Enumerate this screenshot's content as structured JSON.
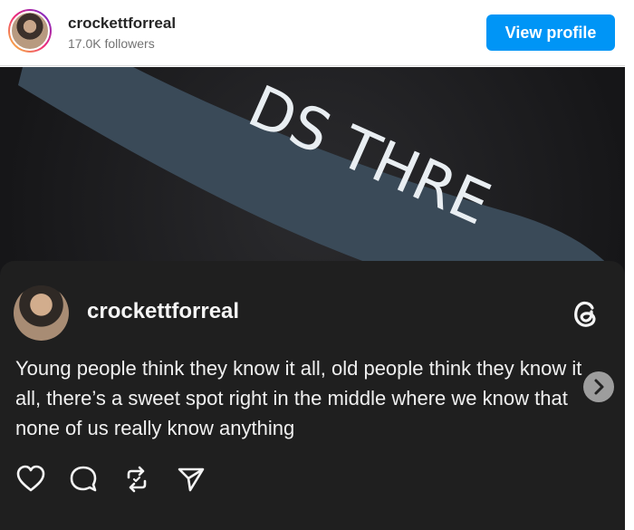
{
  "header": {
    "username": "crockettforreal",
    "followers": "17.0K followers",
    "view_profile_label": "View profile"
  },
  "background": {
    "banner_text": "DS THRE"
  },
  "post": {
    "username": "crockettforreal",
    "text": "Young people think they know it all, old people think they know it all, there’s a sweet spot right in the middle where we know that none of us really know anything"
  },
  "icons": {
    "threads": "threads-logo-icon",
    "next": "chevron-right-icon",
    "like": "heart-icon",
    "comment": "comment-icon",
    "repost": "repost-icon",
    "share": "send-icon"
  },
  "colors": {
    "accent": "#0095f6",
    "card_bg": "#1f1f1f",
    "banner": "#3a4a58"
  }
}
